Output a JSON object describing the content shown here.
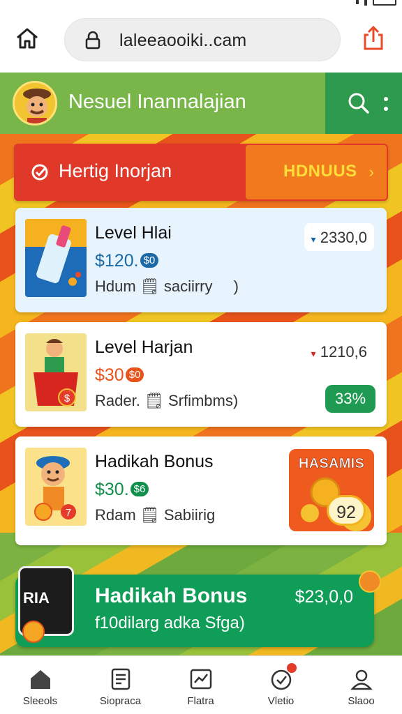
{
  "browser": {
    "url": "laleeaooiki..cam"
  },
  "header": {
    "title": "Nesuel Inannalajian"
  },
  "promo": {
    "text": "Hertig Inorjan",
    "bonus_label": "HDNUUS",
    "chevron": "›"
  },
  "cards": [
    {
      "title": "Level Hlai",
      "price": "$120.",
      "chip": "$0",
      "subtitle": "Hdum 🗒 saciirry",
      "stat": "2330,0",
      "stat_arrow": "▾",
      "chevron": ")"
    },
    {
      "title": "Level Harjan",
      "price": "$30",
      "chip": "$0",
      "subtitle": "Rader. 🗒 Srfimbms)",
      "stat": "1210,6",
      "stat_arrow": "▾",
      "badge": "33%"
    },
    {
      "title": "Hadikah Bonus",
      "price": "$30.",
      "chip": "$6",
      "subtitle": "Rdam 🗒 Sabiirig",
      "art_label": "HASAMIS",
      "art_number": "92"
    }
  ],
  "green_banner": {
    "title": "Hadikah Bonus",
    "amount": "$23,0,0",
    "subtitle": "f10dilarg adka Sfga)",
    "phone_text": "RIA"
  },
  "bottom_nav": [
    {
      "label": "Sleeols",
      "icon": "home-icon"
    },
    {
      "label": "Siopraca",
      "icon": "document-icon"
    },
    {
      "label": "Flatra",
      "icon": "chart-icon"
    },
    {
      "label": "Vletio",
      "icon": "check-badge-icon"
    },
    {
      "label": "Slaoo",
      "icon": "profile-icon"
    }
  ],
  "colors": {
    "header_green": "#79b64a",
    "header_dark_green": "#2e9a4e",
    "promo_red": "#e0392a",
    "promo_orange": "#f17a1f",
    "price_blue": "#1b6aa5",
    "price_orange": "#e8531b",
    "price_green": "#0f8f4b",
    "banner_green": "#0f9d58"
  }
}
